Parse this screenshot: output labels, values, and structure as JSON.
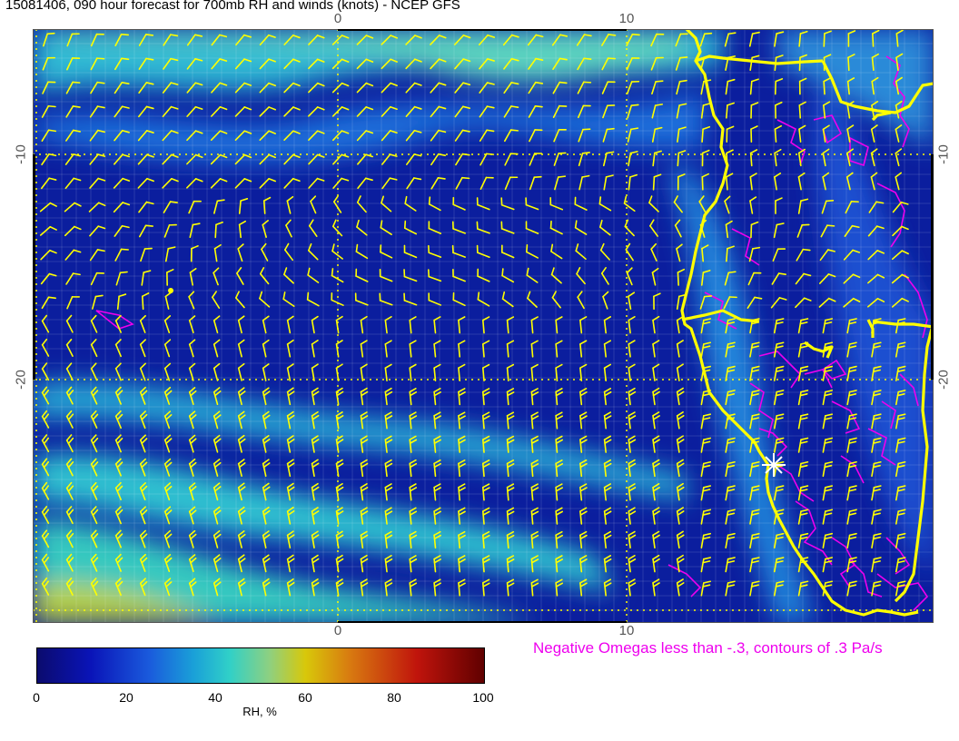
{
  "title": "15081406, 090 hour forecast for 700mb RH and winds (knots) - NCEP GFS",
  "axes": {
    "top_ticks": [
      "0",
      "10"
    ],
    "bottom_ticks": [
      "0",
      "10"
    ],
    "left_ticks": [
      "-10",
      "-20"
    ],
    "right_ticks": [
      "-10",
      "-20"
    ]
  },
  "colorbar": {
    "labels": [
      "0",
      "20",
      "40",
      "60",
      "80",
      "100"
    ],
    "title": "RH, %",
    "colors": [
      "#0b0b6e",
      "#0a14b8",
      "#1a5adc",
      "#1aa0d8",
      "#30d0c8",
      "#8ed080",
      "#d8c80a",
      "#d87a10",
      "#c0140c",
      "#600000"
    ]
  },
  "omega_note": "Negative Omegas less than -.3, contours of .3 Pa/s",
  "colors": {
    "wind_barbs": "#ffff00",
    "coastline": "#ffff00",
    "omega_contours": "#ee00ee",
    "base_field": "#0a1a9a"
  },
  "map_features": [
    "rh-field",
    "wind-barbs",
    "coastline",
    "state-borders",
    "omega-contours",
    "grid-lines",
    "star-marker"
  ]
}
